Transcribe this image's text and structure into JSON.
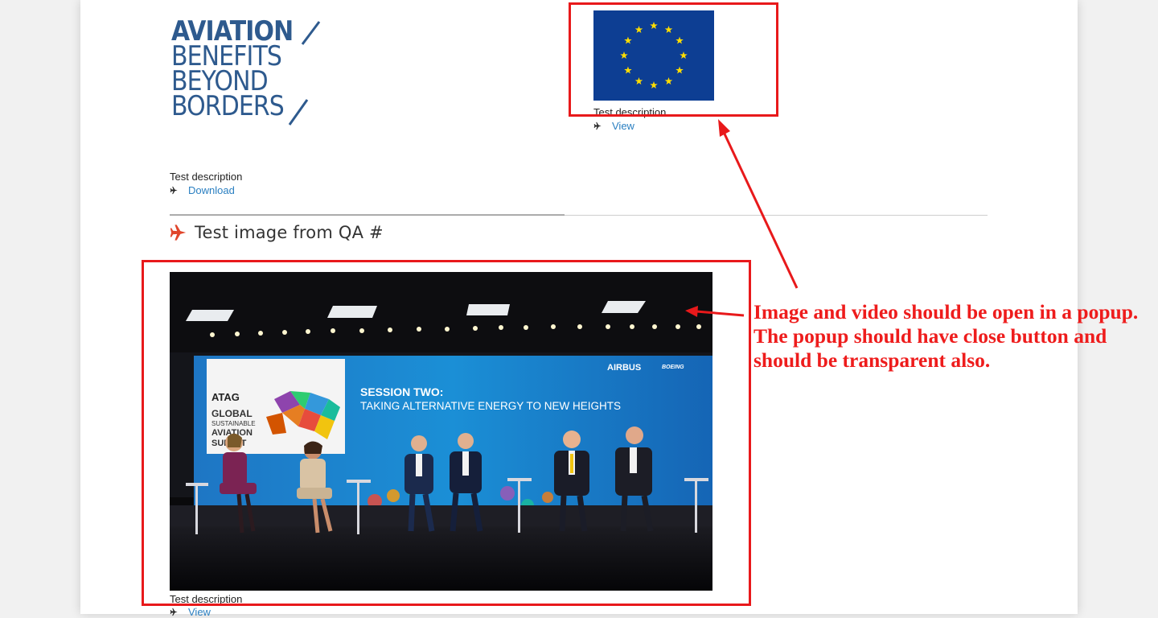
{
  "logo": {
    "line1": "AVIATION",
    "line2": "BENEFITS",
    "line3": "BEYOND",
    "line4": "BORDERS",
    "color": "#2e5a8e"
  },
  "items": [
    {
      "description": "Test description",
      "action": "Download"
    },
    {
      "description": "Test description",
      "action": "View"
    },
    {
      "description": "Test description",
      "action": "View"
    }
  ],
  "section": {
    "title": "Test image from QA #",
    "icon": "plane-icon",
    "icon_color": "#e0452b"
  },
  "photo": {
    "banner_session": "SESSION TWO:",
    "banner_subtitle": "TAKING ALTERNATIVE ENERGY TO NEW HEIGHTS",
    "sponsor1": "AIRBUS",
    "sponsor2": "BOEING",
    "panel_org": "ATAG",
    "panel_line1": "GLOBAL",
    "panel_line2": "SUSTAINABLE",
    "panel_line3": "AVIATION",
    "panel_line4": "SUMMIT"
  },
  "annotation": {
    "text": "Image and video should be open in a popup. The popup should have close button and should be transparent also.",
    "color": "#ee1c1c"
  },
  "colors": {
    "link": "#2a7fc1",
    "eu_blue": "#0d3e93",
    "eu_star": "#ffdd00"
  }
}
